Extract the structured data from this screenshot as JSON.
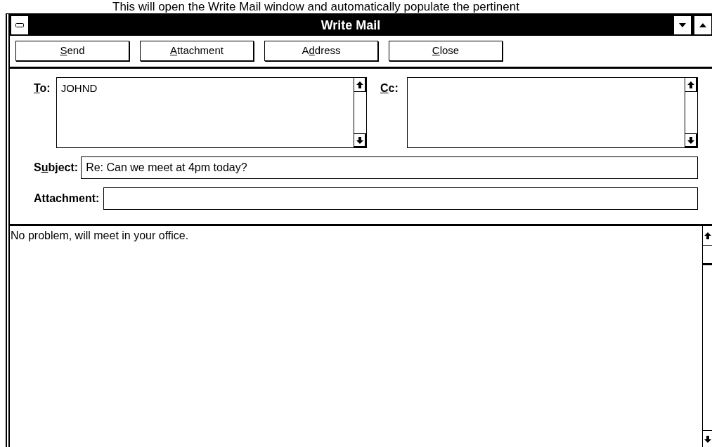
{
  "document_text": "This will open the Write Mail window and automatically populate the pertinent",
  "window": {
    "title": "Write Mail"
  },
  "toolbar": [
    {
      "label": [
        {
          "text": "S",
          "underlined": true
        },
        {
          "text": "end",
          "underlined": false
        }
      ]
    },
    {
      "label": [
        {
          "text": "A",
          "underlined": true
        },
        {
          "text": "ttachment",
          "underlined": false
        }
      ]
    },
    {
      "label": [
        {
          "text": "A",
          "underlined": false
        },
        {
          "text": "d",
          "underlined": true
        },
        {
          "text": "dress",
          "underlined": false
        }
      ]
    },
    {
      "label": [
        {
          "text": "C",
          "underlined": true
        },
        {
          "text": "lose",
          "underlined": false
        }
      ]
    }
  ],
  "to": {
    "label": [
      {
        "text": "T",
        "underlined": true
      },
      {
        "text": "o:",
        "underlined": false
      }
    ],
    "value": "JOHND"
  },
  "cc": {
    "label": [
      {
        "text": "C",
        "underlined": true
      },
      {
        "text": "c:",
        "underlined": false
      }
    ]
  },
  "subject": {
    "label": [
      {
        "text": "S",
        "underlined": false
      },
      {
        "text": "u",
        "underlined": true
      },
      {
        "text": "bject:",
        "underlined": false
      }
    ],
    "value": "Re: Can we meet at 4pm today?"
  },
  "attachment": {
    "label": [
      {
        "text": "Attachment:",
        "underlined": false
      }
    ]
  },
  "body": {
    "text": "No problem, will meet in your office."
  }
}
